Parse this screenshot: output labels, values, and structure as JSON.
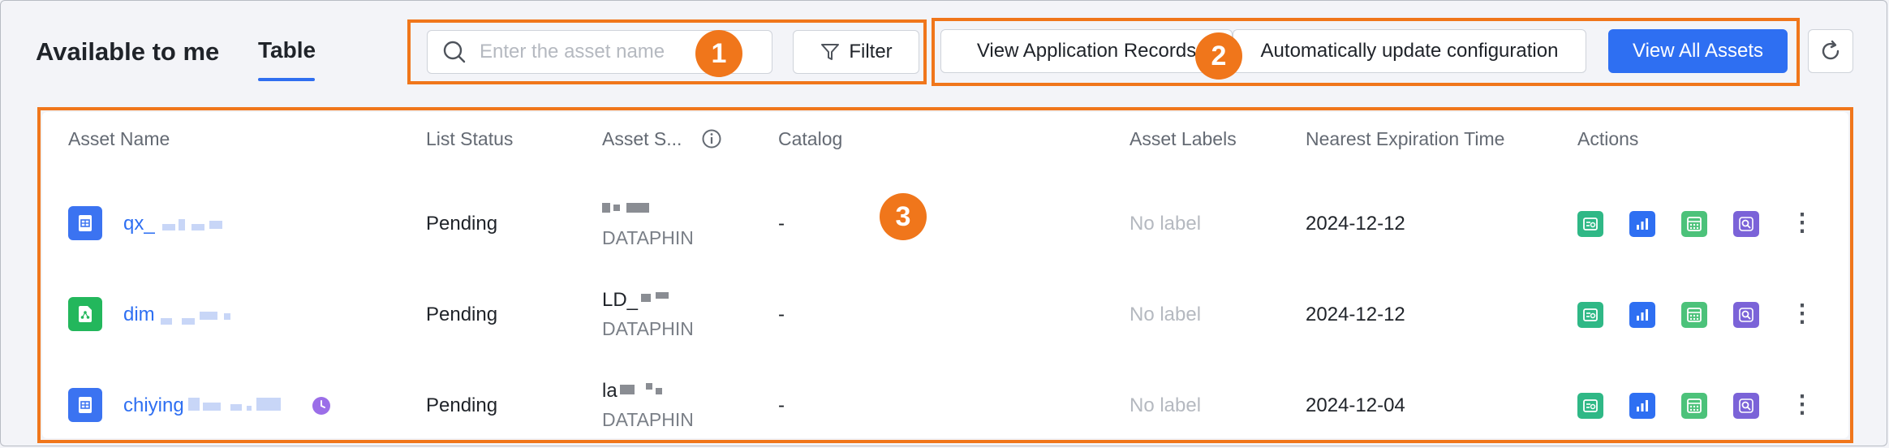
{
  "header": {
    "title": "Available to me",
    "tab": "Table"
  },
  "annotations": [
    "1",
    "2",
    "3"
  ],
  "toolbar": {
    "search_placeholder": "Enter the asset name",
    "filter_label": "Filter",
    "records_label": "View Application Records",
    "auto_label": "Automatically update configuration",
    "view_all_label": "View All Assets"
  },
  "table": {
    "columns": [
      "Asset Name",
      "List Status",
      "Asset S...",
      "Catalog",
      "Asset Labels",
      "Nearest Expiration Time",
      "Actions"
    ],
    "rows": [
      {
        "name": "qx_",
        "status": "Pending",
        "source_top": "",
        "source_bottom": "DATAPHIN",
        "catalog": "-",
        "labels": "No label",
        "expiration": "2024-12-12"
      },
      {
        "name": "dim",
        "status": "Pending",
        "source_top": "LD_",
        "source_bottom": "DATAPHIN",
        "catalog": "-",
        "labels": "No label",
        "expiration": "2024-12-12"
      },
      {
        "name": "chiying",
        "status": "Pending",
        "source_top": "la",
        "source_bottom": "DATAPHIN",
        "catalog": "-",
        "labels": "No label",
        "expiration": "2024-12-04"
      }
    ]
  },
  "colors": {
    "accent": "#2e6ff2",
    "annotation": "#f0761b"
  },
  "icons": [
    "search-icon",
    "filter-icon",
    "refresh-icon",
    "table-file-icon",
    "share-file-icon",
    "clock-icon",
    "preview-icon",
    "chart-icon",
    "calculator-icon",
    "query-icon",
    "more-icon"
  ]
}
